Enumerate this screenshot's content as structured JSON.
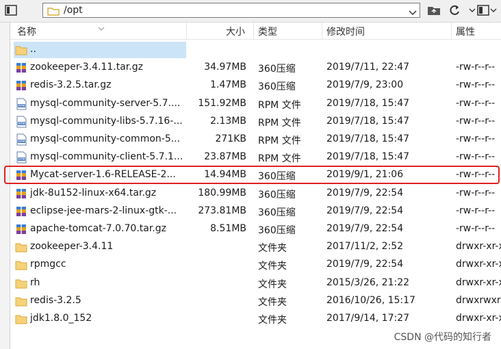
{
  "path": "/opt",
  "header": {
    "name": "名称",
    "size": "大小",
    "type": "类型",
    "modified": "修改时间",
    "attributes": "属性"
  },
  "files": [
    {
      "name": "..",
      "size": "",
      "type": "",
      "modified": "",
      "attr": "",
      "icon": "folder-icon",
      "selected": true
    },
    {
      "name": "zookeeper-3.4.11.tar.gz",
      "size": "34.97MB",
      "type": "360压缩",
      "modified": "2019/7/11, 22:47",
      "attr": "-rw-r--r--",
      "icon": "archive-icon"
    },
    {
      "name": "redis-3.2.5.tar.gz",
      "size": "1.47MB",
      "type": "360压缩",
      "modified": "2019/7/9, 23:00",
      "attr": "-rw-r--r--",
      "icon": "archive-icon"
    },
    {
      "name": "mysql-community-server-5.7....",
      "size": "151.92MB",
      "type": "RPM 文件",
      "modified": "2019/7/18, 15:47",
      "attr": "-rw-r--r--",
      "icon": "rpm-file-icon"
    },
    {
      "name": "mysql-community-libs-5.7.16-...",
      "size": "2.13MB",
      "type": "RPM 文件",
      "modified": "2019/7/18, 15:47",
      "attr": "-rw-r--r--",
      "icon": "rpm-file-icon"
    },
    {
      "name": "mysql-community-common-5...",
      "size": "271KB",
      "type": "RPM 文件",
      "modified": "2019/7/18, 15:47",
      "attr": "-rw-r--r--",
      "icon": "rpm-file-icon"
    },
    {
      "name": "mysql-community-client-5.7.1...",
      "size": "23.87MB",
      "type": "RPM 文件",
      "modified": "2019/7/18, 15:47",
      "attr": "-rw-r--r--",
      "icon": "rpm-file-icon"
    },
    {
      "name": "Mycat-server-1.6-RELEASE-2...",
      "size": "14.94MB",
      "type": "360压缩",
      "modified": "2019/9/1, 21:06",
      "attr": "-rw-r--r--",
      "icon": "archive-icon",
      "highlighted": true
    },
    {
      "name": "jdk-8u152-linux-x64.tar.gz",
      "size": "180.99MB",
      "type": "360压缩",
      "modified": "2019/7/9, 22:54",
      "attr": "-rw-r--r--",
      "icon": "archive-icon"
    },
    {
      "name": "eclipse-jee-mars-2-linux-gtk-...",
      "size": "273.81MB",
      "type": "360压缩",
      "modified": "2019/7/9, 22:54",
      "attr": "-rw-r--r--",
      "icon": "archive-icon"
    },
    {
      "name": "apache-tomcat-7.0.70.tar.gz",
      "size": "8.51MB",
      "type": "360压缩",
      "modified": "2019/7/9, 22:54",
      "attr": "-rw-r--r--",
      "icon": "archive-icon"
    },
    {
      "name": "zookeeper-3.4.11",
      "size": "",
      "type": "文件夹",
      "modified": "2017/11/2, 2:52",
      "attr": "drwxr-xr-x",
      "icon": "folder-icon"
    },
    {
      "name": "rpmgcc",
      "size": "",
      "type": "文件夹",
      "modified": "2019/7/9, 22:54",
      "attr": "drwxr-xr-x",
      "icon": "folder-icon"
    },
    {
      "name": "rh",
      "size": "",
      "type": "文件夹",
      "modified": "2015/3/26, 21:22",
      "attr": "drwxr-xr-x",
      "icon": "folder-icon"
    },
    {
      "name": "redis-3.2.5",
      "size": "",
      "type": "文件夹",
      "modified": "2016/10/26, 15:17",
      "attr": "drwxrwxrwx",
      "icon": "folder-icon"
    },
    {
      "name": "jdk1.8.0_152",
      "size": "",
      "type": "文件夹",
      "modified": "2017/9/14, 17:27",
      "attr": "drwxr-xr-x",
      "icon": "folder-icon"
    }
  ],
  "watermark": "CSDN @代码的知行者",
  "colors": {
    "selection": "#cce4f7",
    "highlight": "#e02020",
    "folder": "#f5c95a"
  }
}
